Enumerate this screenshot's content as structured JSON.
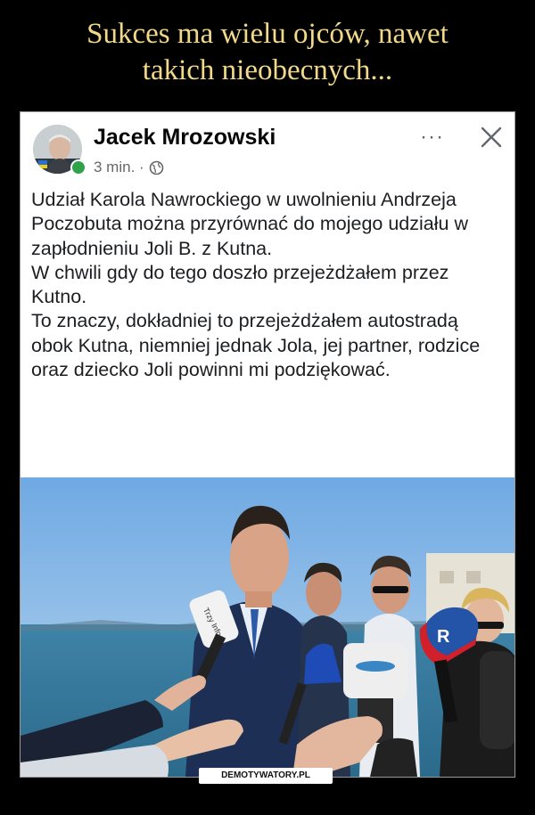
{
  "headline": {
    "line1": "Sukces ma wielu ojców, nawet",
    "line2": "takich nieobecnych..."
  },
  "post": {
    "author": "Jacek Mrozowski",
    "time": "3 min. ·",
    "paragraphs": [
      "Udział Karola Nawrockiego w uwolnieniu Andrzeja Poczobuta można przyrównać do mojego udziału w zapłodnieniu Joli B. z Kutna.",
      "W chwili gdy do tego doszło przejeżdżałem przez Kutno.",
      "To znaczy, dokładniej to przejeżdżałem autostradą obok Kutna, niemniej jednak Jola, jej partner, rodzice oraz dziecko Joli powinni mi podziękować."
    ],
    "more_label": "···"
  },
  "photo": {
    "mic_label_left": "Trzy Info",
    "mic_label_right": "R"
  },
  "watermark": "DEMOTYWATORY.PL",
  "colors": {
    "headline": "#f2d98a",
    "background": "#000000",
    "online": "#31a24c"
  }
}
